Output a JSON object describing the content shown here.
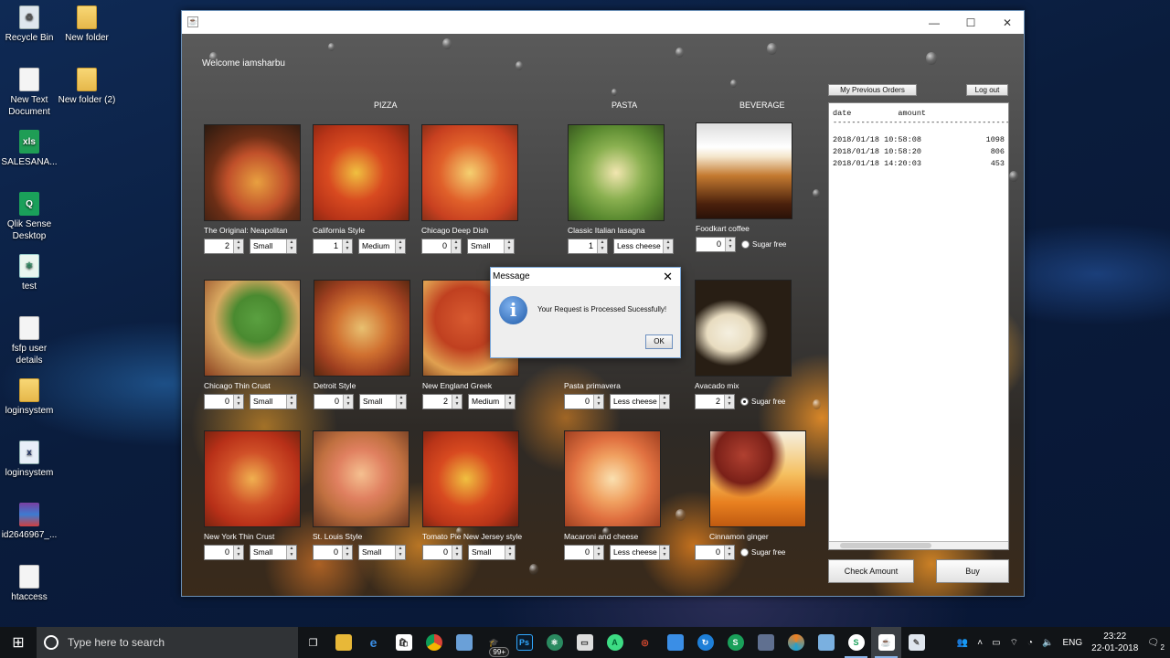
{
  "desktop": {
    "icons": [
      {
        "label": "Recycle Bin",
        "icon": "recycle-bin-icon"
      },
      {
        "label": "New folder",
        "icon": "folder-icon"
      },
      {
        "label": "New Text Document",
        "icon": "text-document-icon"
      },
      {
        "label": "New folder (2)",
        "icon": "folder-icon"
      },
      {
        "label": "SALESANA...",
        "icon": "excel-icon"
      },
      {
        "label": "Qlik Sense Desktop",
        "icon": "qlik-icon"
      },
      {
        "label": "test",
        "icon": "atom-icon"
      },
      {
        "label": "fsfp user details",
        "icon": "text-document-icon"
      },
      {
        "label": "loginsystem",
        "icon": "folder-icon"
      },
      {
        "label": "loginsystem",
        "icon": "excel-file-icon"
      },
      {
        "label": "id2646967_...",
        "icon": "winrar-icon"
      },
      {
        "label": "htaccess",
        "icon": "text-document-icon"
      }
    ]
  },
  "window": {
    "title_icon": "java-icon",
    "minimize": "—",
    "maximize": "☐",
    "close": "✕"
  },
  "app": {
    "welcome": "Welcome iamsharbu",
    "categories": {
      "pizza": "PIZZA",
      "pasta": "PASTA",
      "beverage": "BEVERAGE"
    },
    "items": [
      {
        "name": "The Original: Neapolitan",
        "qty": "2",
        "option": "Small"
      },
      {
        "name": "California Style",
        "qty": "1",
        "option": "Medium"
      },
      {
        "name": "Chicago Deep Dish",
        "qty": "0",
        "option": "Small"
      },
      {
        "name": "Classic Italian lasagna",
        "qty": "1",
        "option": "Less cheese"
      },
      {
        "name": "Foodkart coffee",
        "qty": "0",
        "option": "Sugar free"
      },
      {
        "name": "Chicago Thin Crust",
        "qty": "0",
        "option": "Small"
      },
      {
        "name": "Detroit Style",
        "qty": "0",
        "option": "Small"
      },
      {
        "name": "New England Greek",
        "qty": "2",
        "option": "Medium"
      },
      {
        "name": "Pasta primavera",
        "qty": "0",
        "option": "Less cheese"
      },
      {
        "name": "Avacado mix",
        "qty": "2",
        "option": "Sugar free"
      },
      {
        "name": "New York Thin Crust",
        "qty": "0",
        "option": "Small"
      },
      {
        "name": "St. Louis Style",
        "qty": "0",
        "option": "Small"
      },
      {
        "name": "Tomato Pie New Jersey style",
        "qty": "0",
        "option": "Small"
      },
      {
        "name": "Macaroni and cheese",
        "qty": "0",
        "option": "Less cheese"
      },
      {
        "name": "Cinnamon ginger",
        "qty": "0",
        "option": "Sugar free"
      }
    ],
    "buttons": {
      "previous_orders": "My Previous Orders",
      "logout": "Log out",
      "check_amount": "Check Amount",
      "buy": "Buy"
    },
    "orders": {
      "col_date": "date",
      "col_amount": "amount",
      "rule": "--------------------------------------------------",
      "rows": [
        {
          "date": "2018/01/18 10:58:08",
          "amount": "1098"
        },
        {
          "date": "2018/01/18 10:58:20",
          "amount": "806"
        },
        {
          "date": "2018/01/18 14:20:03",
          "amount": "453"
        }
      ]
    }
  },
  "dialog": {
    "title": "Message",
    "close": "✕",
    "message": "Your Request is Processed Sucessfully!",
    "ok": "OK",
    "icon": "info-icon"
  },
  "taskbar": {
    "search_placeholder": "Type here to search",
    "language": "ENG",
    "time": "23:22",
    "date": "22-01-2018",
    "badge": "99+",
    "notification_count": "2"
  }
}
